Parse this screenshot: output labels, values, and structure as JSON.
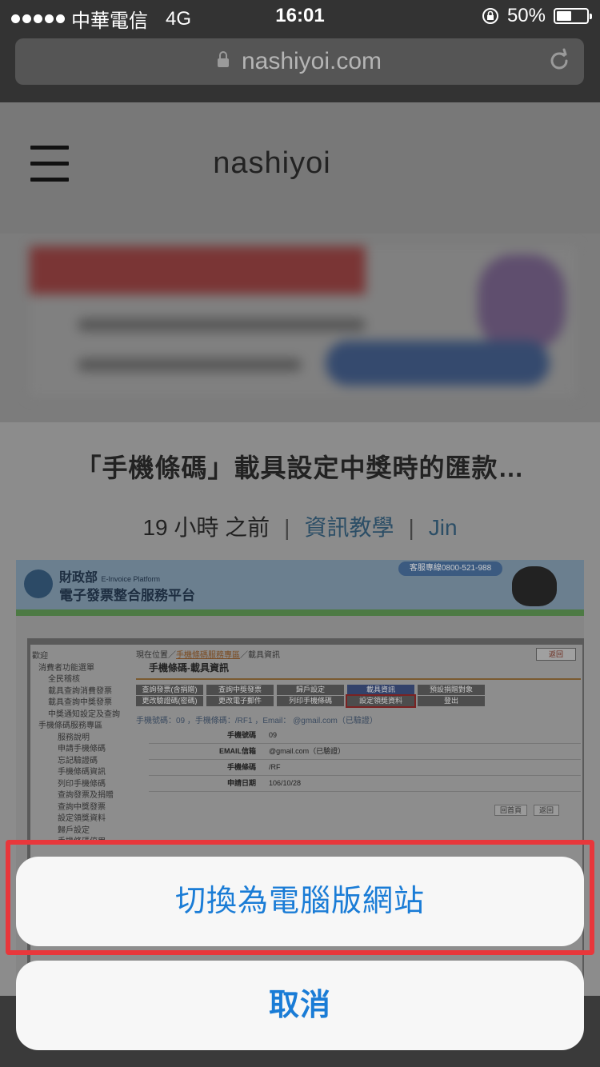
{
  "status_bar": {
    "carrier": "中華電信",
    "network": "4G",
    "time": "16:01",
    "battery": "50%",
    "battery_level": 0.5
  },
  "browser": {
    "url": "nashiyoi.com",
    "icons": [
      "lock-icon",
      "reload-icon"
    ]
  },
  "site": {
    "name": "nashiyoi",
    "menu_icon": "hamburger-icon"
  },
  "article": {
    "title": "「手機條碼」載具設定中獎時的匯款…",
    "time_ago": "19 小時 之前",
    "category": "資訊教學",
    "author": "Jin",
    "separator": "|"
  },
  "screenshot": {
    "header": {
      "logo_title": "財政部",
      "logo_subtitle_en": "E-Invoice Platform",
      "platform_name": "電子發票整合服務平台",
      "hotline": "客服專線0800-521-988"
    },
    "sidebar": [
      "歡迎",
      "消費者功能選單",
      "全民稽核",
      "載具查詢消費發票",
      "載具查詢中獎發票",
      "中獎通知設定及查詢",
      "手機條碼服務專區",
      "服務說明",
      "申請手機條碼",
      "忘記驗證碼",
      "手機條碼資訊",
      "列印手機條碼",
      "查詢發票及捐贈",
      "查詢中獎發票",
      "設定領獎資料",
      "歸戶設定",
      "手機條碼停用"
    ],
    "breadcrumb": {
      "prefix": "現在位置／",
      "link": "手機條碼服務專區",
      "current": "／載具資訊"
    },
    "back_label": "返回",
    "page_heading": "手機條碼-載具資訊",
    "tabs": [
      "查詢發票(含捐贈)",
      "查詢中獎發票",
      "歸戶設定",
      "載具資訊",
      "更改驗證碼(密碼)",
      "更改電子郵件",
      "列印手機條碼",
      "設定領獎資料",
      "預設捐贈對象",
      "登出"
    ],
    "summary_line": "手機號碼：09        ，手機條碼：/RF1        ，Email：        @gmail.com（已驗證）",
    "info_rows": [
      {
        "label": "手機號碼",
        "value": "09"
      },
      {
        "label": "EMAIL信箱",
        "value": "@gmail.com（已驗證）"
      },
      {
        "label": "手機條碼",
        "value": "/RF"
      },
      {
        "label": "申請日期",
        "value": "106/10/28"
      }
    ],
    "buttons": [
      "回首頁",
      "返回"
    ]
  },
  "action_sheet": {
    "desktop_site": "切換為電腦版網站",
    "cancel": "取消",
    "highlight_color": "#e8373b",
    "button_text_color": "#1a7cd6"
  }
}
